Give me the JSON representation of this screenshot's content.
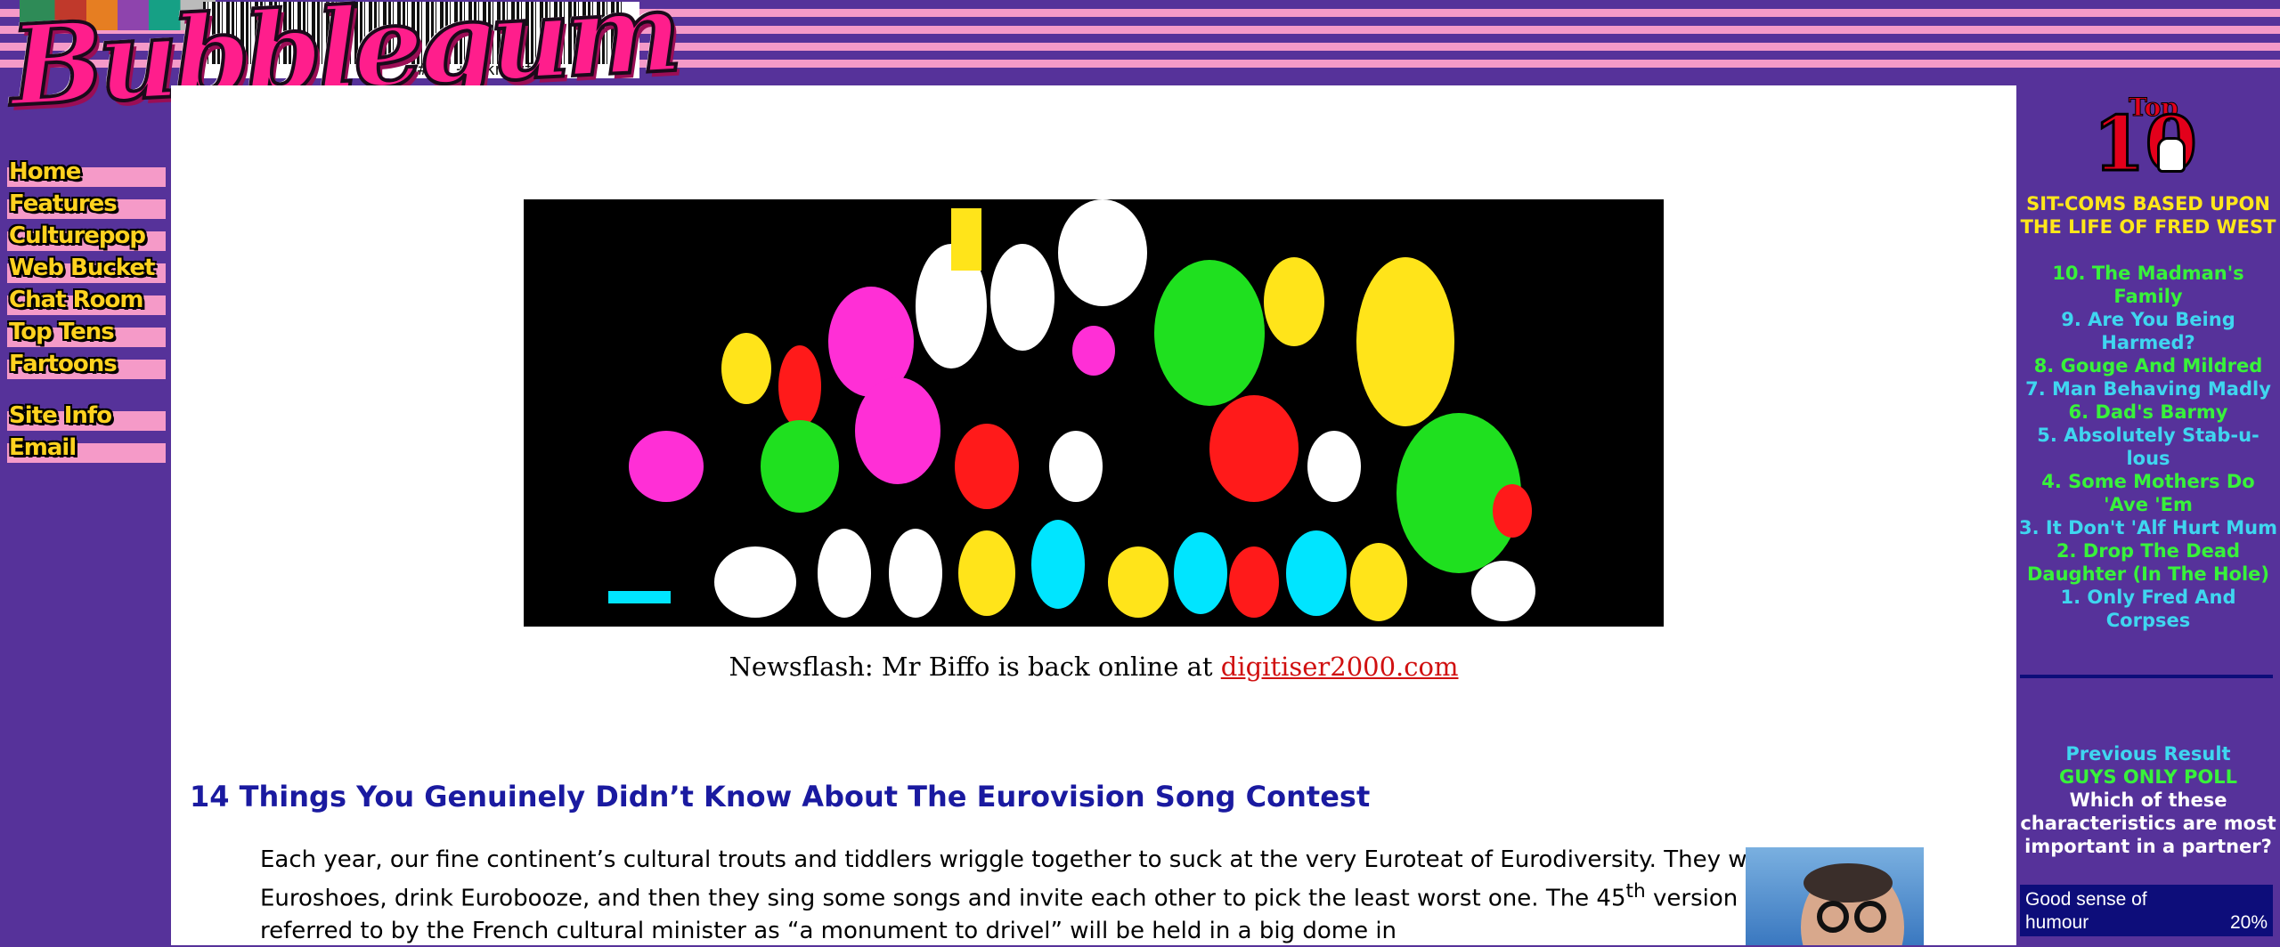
{
  "logo": {
    "word": "Bubblegum",
    "barcode_text": "o#d. ++ knfwf +"
  },
  "nav": {
    "items": [
      {
        "label": "Home"
      },
      {
        "label": "Features"
      },
      {
        "label": "Culturepop"
      },
      {
        "label": "Web Bucket"
      },
      {
        "label": "Chat Room"
      },
      {
        "label": "Top Tens"
      },
      {
        "label": "Fartoons"
      }
    ],
    "items2": [
      {
        "label": "Site Info"
      },
      {
        "label": "Email"
      }
    ]
  },
  "main": {
    "newsflash_prefix": "Newsflash: Mr Biffo is back online at ",
    "newsflash_link": "digitiser2000.com",
    "article_title": "14 Things You Genuinely Didn’t Know About The Eurovision Song Contest",
    "article_body_1": "Each year, our fine continent’s cultural trouts and tiddlers wriggle together to suck at the very Euroteat of Eurodiversity. They wear Euroshoes, drink Eurobooze, and then they sing some songs and invite each other to pick the least worst one. The 45",
    "article_body_sup": "th",
    "article_body_2": " version of a contest referred to by the French cultural minister as “a monument to drivel” will be held in a big dome in"
  },
  "sidebar": {
    "top10_logo_top": "Top",
    "top10_logo_ten": "10",
    "top10_heading": "SIT-COMS BASED UPON THE LIFE OF FRED WEST",
    "top10_items": [
      {
        "text": "10. The Madman's Family",
        "color": "green"
      },
      {
        "text": "9. Are You Being Harmed?",
        "color": "cyan"
      },
      {
        "text": "8. Gouge And Mildred",
        "color": "green"
      },
      {
        "text": "7. Man Behaving Madly",
        "color": "cyan"
      },
      {
        "text": "6. Dad's Barmy",
        "color": "green"
      },
      {
        "text": "5. Absolutely Stab-u-lous",
        "color": "cyan"
      },
      {
        "text": "4. Some Mothers Do 'Ave 'Em",
        "color": "green"
      },
      {
        "text": "3. It Don't 'Alf Hurt Mum",
        "color": "cyan"
      },
      {
        "text": "2. Drop The Dead Daughter (In The Hole)",
        "color": "green"
      },
      {
        "text": "1. Only Fred And Corpses",
        "color": "cyan"
      }
    ],
    "previous_result": "Previous Result",
    "poll_name": "GUYS ONLY POLL",
    "poll_question": "Which of these characteristics are most important in a partner?",
    "poll_option": "Good sense of humour",
    "poll_percent": "20%"
  },
  "colors": {
    "background": "#56329a",
    "stripe_pink": "#f59ac8",
    "nav_yellow": "#ffd21f",
    "title_blue": "#1a1aa0",
    "link_red": "#d01010",
    "sidebar_green": "#38f23a",
    "sidebar_cyan": "#3fd6f0",
    "sidebar_yellow": "#ffe71a"
  }
}
